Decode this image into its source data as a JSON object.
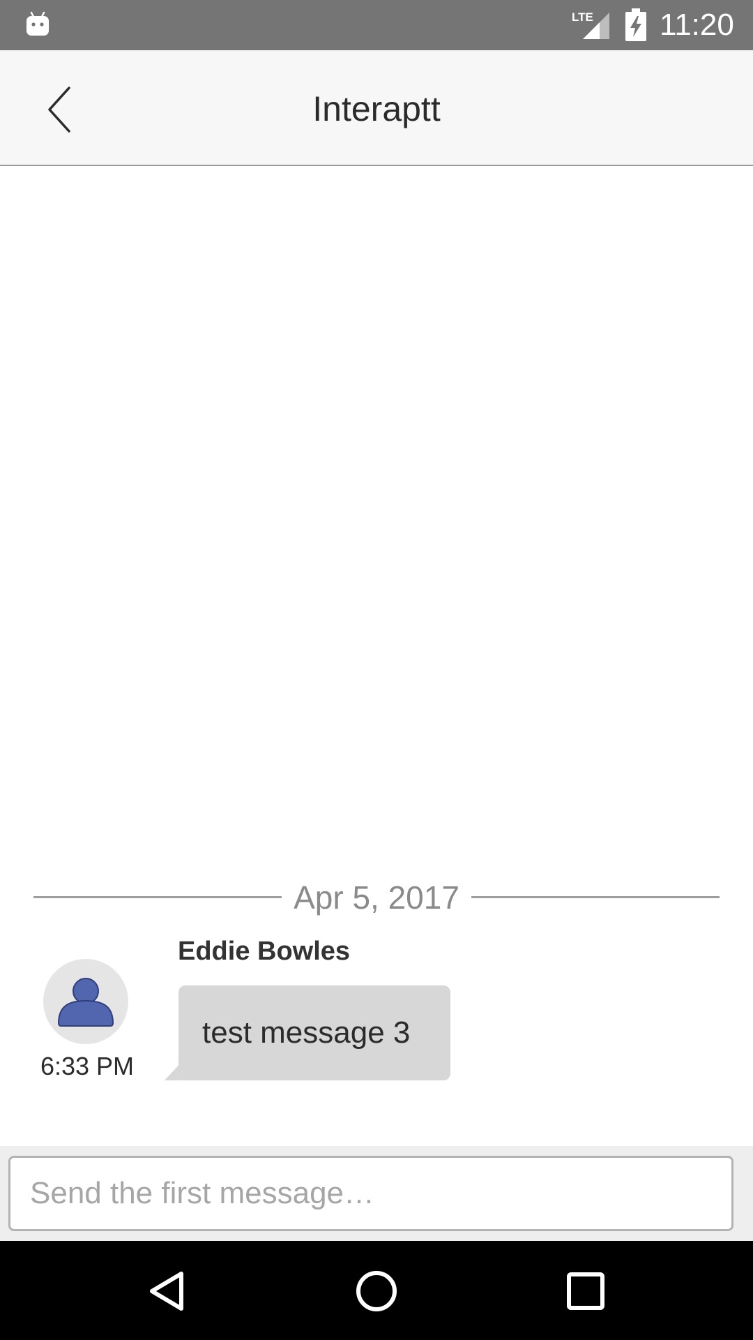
{
  "status_bar": {
    "time": "11:20",
    "network_label": "LTE",
    "app_icon": "android-app-icon",
    "signal_icon": "signal-icon",
    "battery_icon": "battery-charging-icon"
  },
  "header": {
    "title": "Interaptt",
    "back_icon": "chevron-left-icon"
  },
  "conversation": {
    "date_separator": "Apr 5, 2017",
    "messages": [
      {
        "sender": "Eddie Bowles",
        "text": "test message 3",
        "time": "6:33 PM",
        "avatar_icon": "person-icon"
      }
    ]
  },
  "composer": {
    "placeholder": "Send the first message…",
    "value": ""
  },
  "nav_bar": {
    "back_icon": "nav-back-icon",
    "home_icon": "nav-home-icon",
    "recents_icon": "nav-recents-icon"
  },
  "colors": {
    "status_bar": "#757575",
    "header_bg": "#f7f7f7",
    "bubble_bg": "#d7d7d7",
    "avatar_fill": "#5266b0",
    "composer_bg": "#eeeeee"
  }
}
